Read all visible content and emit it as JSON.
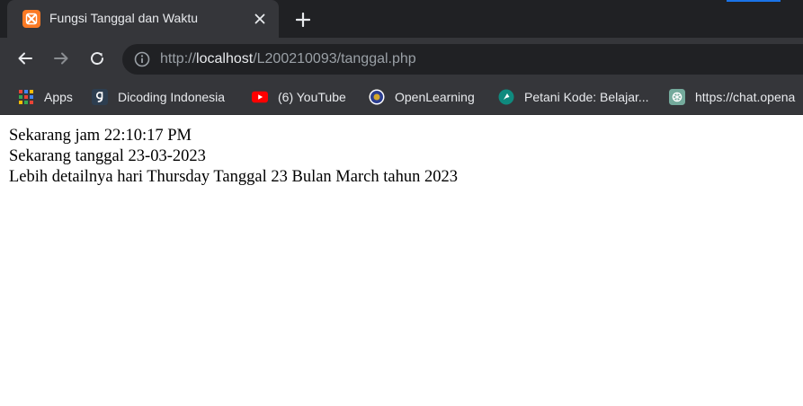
{
  "tab": {
    "title": "Fungsi Tanggal dan Waktu",
    "favicon": "xampp-icon"
  },
  "toolbar": {
    "url_prefix": "http://",
    "url_host": "localhost",
    "url_path": "/L200210093/tanggal.php"
  },
  "bookmarks": [
    {
      "label": "Apps",
      "icon": "apps-grid-icon"
    },
    {
      "label": "Dicoding Indonesia",
      "icon": "dicoding-icon"
    },
    {
      "label": "(6) YouTube",
      "icon": "youtube-icon"
    },
    {
      "label": "OpenLearning",
      "icon": "openlearning-icon"
    },
    {
      "label": "Petani Kode: Belajar...",
      "icon": "petanikode-icon"
    },
    {
      "label": "https://chat.opena",
      "icon": "chatgpt-icon"
    }
  ],
  "page": {
    "line1": "Sekarang jam 22:10:17 PM",
    "line2": "Sekarang tanggal 23-03-2023",
    "line3": "Lebih detailnya hari Thursday Tanggal 23 Bulan March tahun 2023"
  },
  "colors": {
    "tabstrip": "#202124",
    "toolbar": "#35363a",
    "accent": "#1a73e8"
  }
}
